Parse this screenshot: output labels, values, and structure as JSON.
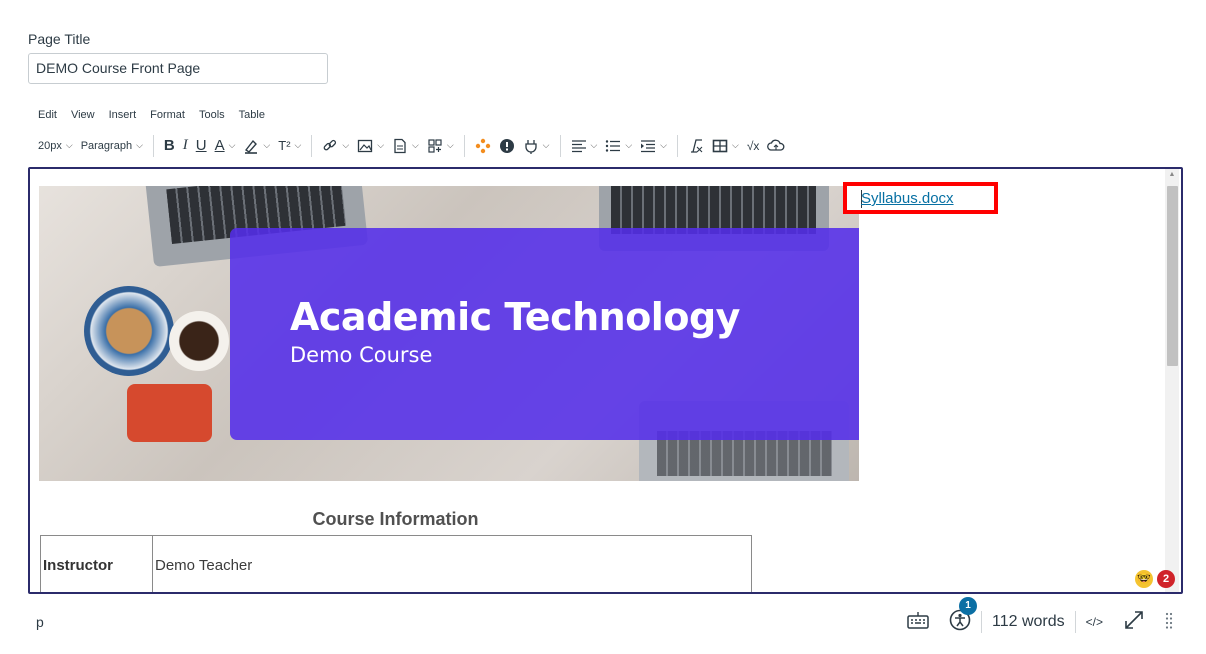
{
  "page_title": {
    "label": "Page Title",
    "value": "DEMO Course Front Page"
  },
  "menubar": [
    "Edit",
    "View",
    "Insert",
    "Format",
    "Tools",
    "Table"
  ],
  "toolbar": {
    "font_size": "20px",
    "block_format": "Paragraph",
    "bold_glyph": "B",
    "italic_glyph": "I",
    "underline_glyph": "U",
    "text_color_glyph": "A",
    "superscript_glyph": "T²",
    "formula_glyph": "√x",
    "chevron": "⌵"
  },
  "banner": {
    "title": "Academic Technology",
    "subtitle": "Demo Course",
    "overlay_color": "#542ee9"
  },
  "link": {
    "text": "Syllabus.docx",
    "color": "#0770a3",
    "highlight_color": "#ff0000"
  },
  "course_info": {
    "heading": "Course Information",
    "rows": [
      {
        "key": "Instructor",
        "value": "Demo Teacher"
      }
    ]
  },
  "editor_badges": {
    "emoji_a": "🤓",
    "emoji_b": "2"
  },
  "statusbar": {
    "path": "p",
    "a11y_badge": "1",
    "word_count": "112 words",
    "html_toggle": "</>"
  }
}
